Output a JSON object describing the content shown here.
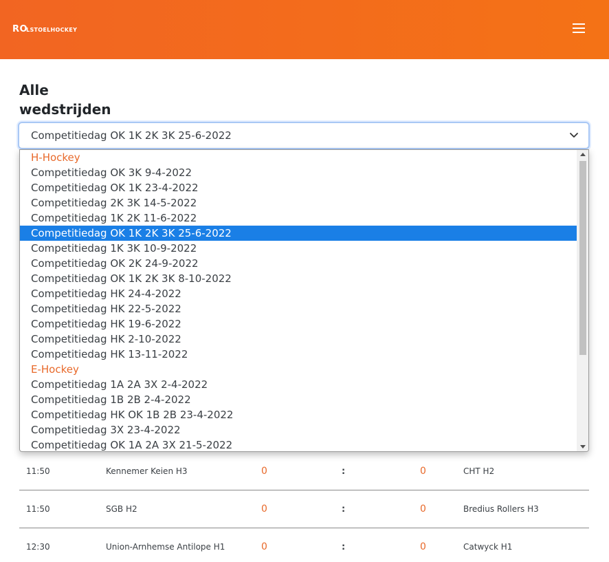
{
  "header": {
    "logo_prefix": "RO",
    "logo_text": "LSTOELHOCKEY",
    "brand_color": "#f26522"
  },
  "page": {
    "title": "Alle wedstrijden"
  },
  "select": {
    "value": "Competitiedag OK 1K 2K 3K 25-6-2022"
  },
  "dropdown": {
    "items": [
      {
        "label": "H-Hockey",
        "group": true
      },
      {
        "label": "Competitiedag OK 3K 9-4-2022"
      },
      {
        "label": "Competitiedag OK 1K 23-4-2022"
      },
      {
        "label": "Competitiedag 2K 3K 14-5-2022"
      },
      {
        "label": "Competitiedag 1K 2K 11-6-2022"
      },
      {
        "label": "Competitiedag OK 1K 2K 3K 25-6-2022",
        "selected": true
      },
      {
        "label": "Competitiedag 1K 3K 10-9-2022"
      },
      {
        "label": "Competitiedag OK 2K 24-9-2022"
      },
      {
        "label": "Competitiedag OK 1K 2K 3K 8-10-2022"
      },
      {
        "label": "Competitiedag HK 24-4-2022"
      },
      {
        "label": "Competitiedag HK 22-5-2022"
      },
      {
        "label": "Competitiedag HK 19-6-2022"
      },
      {
        "label": "Competitiedag HK 2-10-2022"
      },
      {
        "label": "Competitiedag HK 13-11-2022"
      },
      {
        "label": "E-Hockey",
        "group": true
      },
      {
        "label": "Competitiedag 1A 2A 3X 2-4-2022"
      },
      {
        "label": "Competitiedag 1B 2B 2-4-2022"
      },
      {
        "label": "Competitiedag HK OK 1B 2B 23-4-2022"
      },
      {
        "label": "Competitiedag 3X 23-4-2022"
      },
      {
        "label": "Competitiedag OK 1A 2A 3X 21-5-2022"
      }
    ]
  },
  "matches": [
    {
      "time": "11:50",
      "home": "Kennemer Keien H3",
      "score_home": "0",
      "sep": ":",
      "score_away": "0",
      "away": "CHT H2"
    },
    {
      "time": "11:50",
      "home": "SGB H2",
      "score_home": "0",
      "sep": ":",
      "score_away": "0",
      "away": "Bredius Rollers H3"
    },
    {
      "time": "12:30",
      "home": "Union-Arnhemse Antilope H1",
      "score_home": "0",
      "sep": ":",
      "score_away": "0",
      "away": "Catwyck H1"
    }
  ]
}
